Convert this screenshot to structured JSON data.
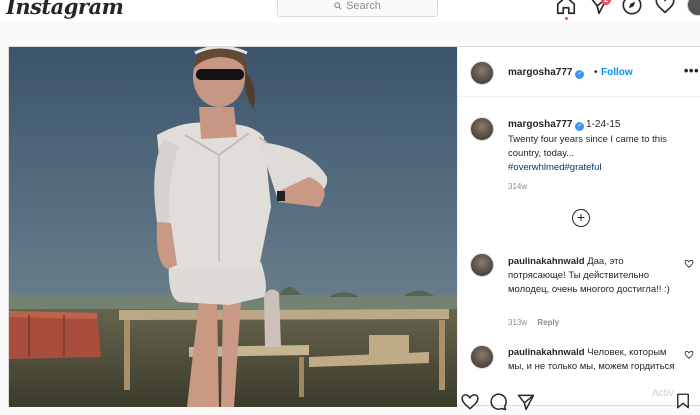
{
  "nav": {
    "logo": "Instagram",
    "search_placeholder": "Search",
    "notification_count": "2",
    "icons": [
      "home-icon",
      "direct-icon",
      "explore-icon",
      "heart-icon",
      "profile-avatar"
    ]
  },
  "post": {
    "header": {
      "username": "margosha777",
      "separator": "•",
      "follow_label": "Follow",
      "more_label": "•••"
    },
    "caption": {
      "username": "margosha777",
      "date": "1-24-15",
      "text": "Twenty four years since I came to this country, today...",
      "hashtags": "#overwhlmed#grateful",
      "age": "314w"
    },
    "load_more_symbol": "+",
    "comments": [
      {
        "username": "paulinakahnwald",
        "text": "Даа, это потрясающе! Ты действительно молодец, очень многого достигла!! :)",
        "age": "313w",
        "reply_label": "Reply"
      },
      {
        "username": "paulinakahnwald",
        "text": "Человек, которым мы, и не только мы, можем гордиться",
        "age": "",
        "reply_label": ""
      }
    ]
  },
  "watermark": "Activ",
  "colors": {
    "accent": "#0095f6",
    "badge": "#ed4956",
    "hashtag": "#00376b",
    "muted": "#8e8e8e"
  }
}
